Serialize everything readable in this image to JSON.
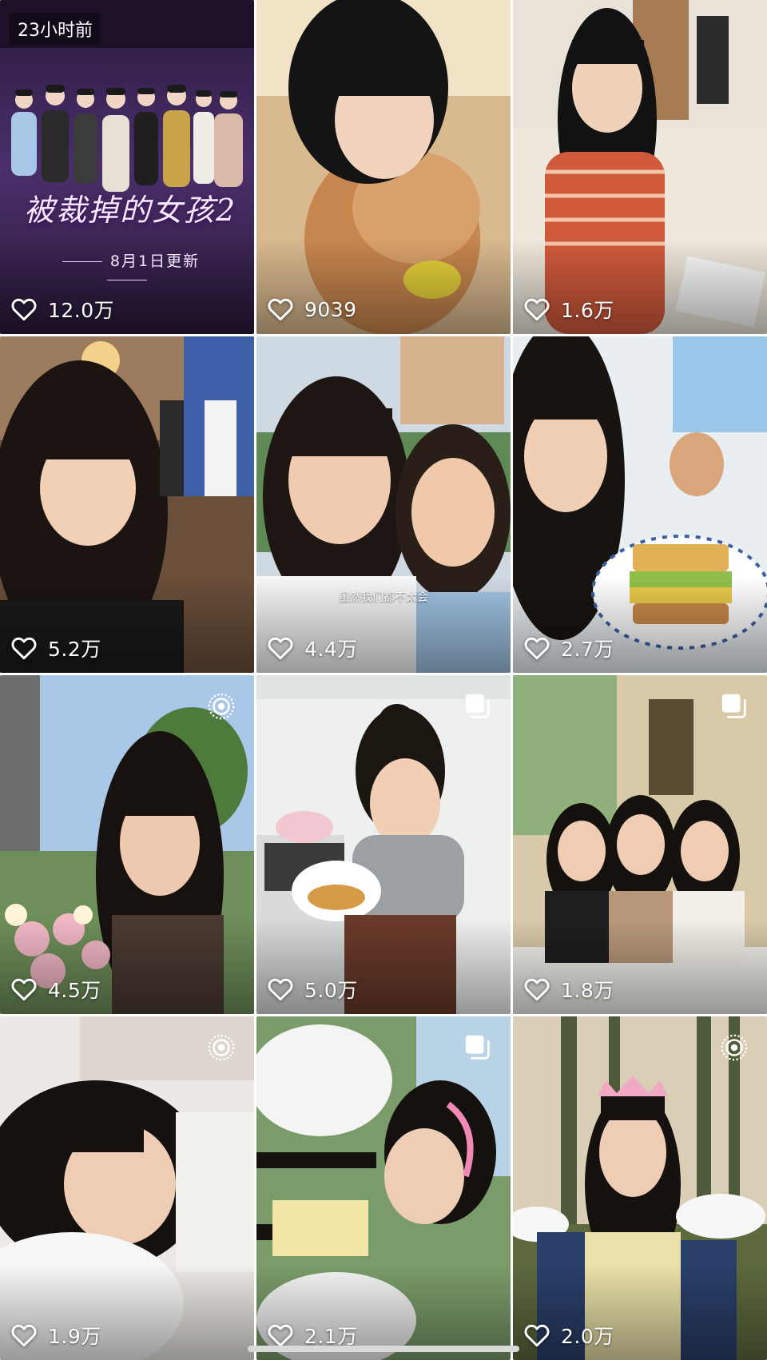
{
  "grid": {
    "tiles": [
      {
        "likes": "12.0万",
        "badge": "23小时前",
        "poster_title": "被裁掉的女孩2",
        "poster_subtitle": "8月1日更新",
        "type_icon": null
      },
      {
        "likes": "9039",
        "type_icon": null
      },
      {
        "likes": "1.6万",
        "type_icon": null
      },
      {
        "likes": "5.2万",
        "type_icon": null
      },
      {
        "likes": "4.4万",
        "caption": "虽然我们都不太会",
        "type_icon": null
      },
      {
        "likes": "2.7万",
        "type_icon": null
      },
      {
        "likes": "4.5万",
        "type_icon": "live-photo-icon"
      },
      {
        "likes": "5.0万",
        "type_icon": "gallery-icon"
      },
      {
        "likes": "1.8万",
        "type_icon": "gallery-icon"
      },
      {
        "likes": "1.9万",
        "type_icon": "live-photo-icon"
      },
      {
        "likes": "2.1万",
        "type_icon": "gallery-icon"
      },
      {
        "likes": "2.0万",
        "type_icon": "live-photo-icon"
      }
    ]
  },
  "colors": {
    "like_text": "#ffffff",
    "background": "#ffffff"
  }
}
